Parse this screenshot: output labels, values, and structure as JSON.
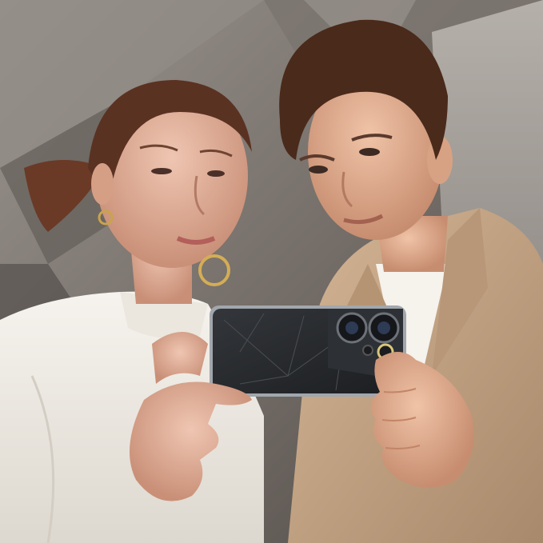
{
  "scene": {
    "subject": "photo",
    "colors": {
      "ceiling_light": "#8d8781",
      "ceiling_dark": "#4f4a46",
      "wall": "#a8a39d",
      "woman_top": "#f1ede6",
      "woman_skin": "#e2b39e",
      "woman_hair": "#5a3222",
      "man_blazer": "#c4a587",
      "man_shirt": "#f6f2ec",
      "man_skin": "#e8b69a",
      "man_hair": "#4a2a1a",
      "phone_body": "#26282b",
      "phone_frame": "#9fa4aa",
      "lens_ring": "#d9c77a"
    },
    "icons": [
      "hoop-earring-icon",
      "camera-lens-icon"
    ]
  }
}
